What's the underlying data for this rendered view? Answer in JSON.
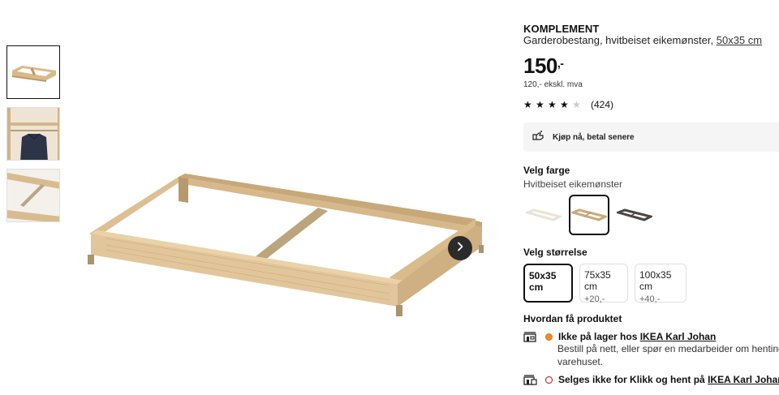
{
  "product": {
    "brand": "KOMPLEMENT",
    "description": "Garderobestang, hvitbeiset eikemønster, ",
    "size_link": "50x35 cm",
    "price": "150",
    "price_suffix": ",-",
    "vat": "120,- ekskl. mva",
    "rating": {
      "stars": 4,
      "max": 5,
      "count": "(424)"
    }
  },
  "klarna": {
    "label": "Kjøp nå, betal senere",
    "icon": "klarna-hand-icon"
  },
  "color": {
    "title": "Velg farge",
    "selected": "Hvitbeiset eikemønster",
    "options": [
      {
        "name": "white",
        "color": "#ece8e0"
      },
      {
        "name": "white-stained-oak",
        "color": "#c9ab7a"
      },
      {
        "name": "dark-grey",
        "color": "#3f3d3a"
      }
    ],
    "selected_index": 1
  },
  "size": {
    "title": "Velg størrelse",
    "options": [
      {
        "label": "50x35 cm",
        "extra": ""
      },
      {
        "label": "75x35 cm",
        "extra": "+20,-"
      },
      {
        "label": "100x35 cm",
        "extra": "+40,-"
      }
    ],
    "selected_index": 0
  },
  "availability": {
    "title": "Hvordan få produktet",
    "store": {
      "icon": "store-icon",
      "status_prefix": "Ikke på lager hos ",
      "store_name": "IKEA Karl Johan",
      "note_line1": "Bestill på nett, eller spør en medarbeider om henting på",
      "note_line2": "varehuset."
    },
    "click_collect": {
      "icon": "click-collect-icon",
      "status_prefix": "Selges ikke for Klikk og hent på ",
      "store_name": "IKEA Karl Johan"
    }
  },
  "gallery": {
    "thumbnails": [
      "frame-thumbnail",
      "wardrobe-thumbnail",
      "rail-detail-thumbnail"
    ],
    "next_icon": "chevron-right-icon"
  }
}
